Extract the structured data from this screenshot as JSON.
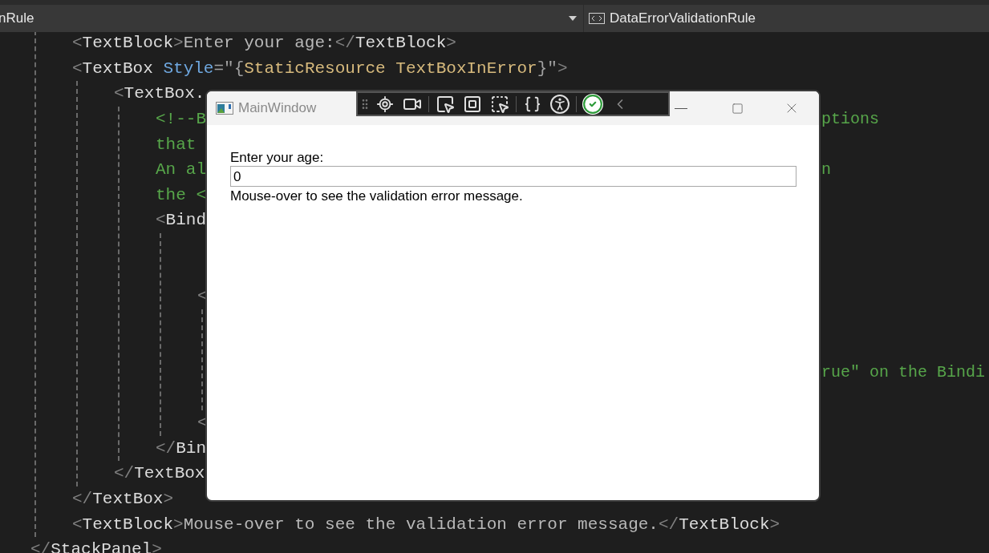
{
  "editor_header": {
    "type_dropdown": "nRule",
    "member_dropdown": "DataErrorValidationRule"
  },
  "code": {
    "lines": [
      {
        "segments": [
          {
            "kind": "bracket",
            "text": "<"
          },
          {
            "kind": "tag",
            "text": "TextBlock"
          },
          {
            "kind": "bracket",
            "text": ">"
          },
          {
            "kind": "text",
            "text": "Enter your age:"
          },
          {
            "kind": "bracket",
            "text": "</"
          },
          {
            "kind": "tag",
            "text": "TextBlock"
          },
          {
            "kind": "bracket",
            "text": ">"
          }
        ]
      },
      {
        "segments": [
          {
            "kind": "bracket",
            "text": "<"
          },
          {
            "kind": "tag",
            "text": "TextBox "
          },
          {
            "kind": "attr",
            "text": "Style"
          },
          {
            "kind": "punct",
            "text": "=\"{"
          },
          {
            "kind": "value",
            "text": "StaticResource TextBoxInError"
          },
          {
            "kind": "punct",
            "text": "}\""
          },
          {
            "kind": "bracket",
            "text": ">"
          }
        ],
        "children": [
          {
            "segments": [
              {
                "kind": "bracket",
                "text": "<"
              },
              {
                "kind": "tag",
                "text": "TextBox."
              }
            ],
            "children": [
              {
                "segments": [
                  {
                    "kind": "comment",
                    "text": "<!--B"
                  }
                ],
                "right": [
                  {
                    "kind": "comment",
                    "text": "ptions"
                  }
                ]
              },
              {
                "segments": [
                  {
                    "kind": "comment",
                    "text": "that"
                  }
                ]
              },
              {
                "segments": [
                  {
                    "kind": "comment",
                    "text": "An al"
                  }
                ],
                "right": [
                  {
                    "kind": "comment",
                    "text": "n"
                  }
                ]
              },
              {
                "segments": [
                  {
                    "kind": "comment",
                    "text": "the <"
                  }
                ]
              },
              {
                "segments": [
                  {
                    "kind": "bracket",
                    "text": "<"
                  },
                  {
                    "kind": "tag",
                    "text": "Bind"
                  }
                ],
                "children": [
                  {
                    "kind": "covered"
                  },
                  {
                    "kind": "covered"
                  },
                  {
                    "segments": [
                      {
                        "kind": "bracket",
                        "text": "<"
                      }
                    ],
                    "children": [
                      {
                        "kind": "covered"
                      },
                      {
                        "kind": "covered"
                      },
                      {
                        "kind": "covered",
                        "right": [
                          {
                            "kind": "comment",
                            "text": "rue\" on the Bindi"
                          }
                        ]
                      },
                      {
                        "kind": "covered"
                      }
                    ]
                  },
                  {
                    "segments": [
                      {
                        "kind": "bracket",
                        "text": "<"
                      }
                    ]
                  }
                ]
              },
              {
                "segments": [
                  {
                    "kind": "bracket",
                    "text": "</"
                  },
                  {
                    "kind": "tag",
                    "text": "Bin"
                  }
                ]
              }
            ]
          },
          {
            "segments": [
              {
                "kind": "bracket",
                "text": "</"
              },
              {
                "kind": "tag",
                "text": "TextBox"
              }
            ]
          }
        ]
      },
      {
        "segments": [
          {
            "kind": "bracket",
            "text": "</"
          },
          {
            "kind": "tag",
            "text": "TextBox"
          },
          {
            "kind": "bracket",
            "text": ">"
          }
        ]
      },
      {
        "segments": [
          {
            "kind": "bracket",
            "text": "<"
          },
          {
            "kind": "tag",
            "text": "TextBlock"
          },
          {
            "kind": "bracket",
            "text": ">"
          },
          {
            "kind": "text",
            "text": "Mouse-over to see the validation error message."
          },
          {
            "kind": "bracket",
            "text": "</"
          },
          {
            "kind": "tag",
            "text": "TextBlock"
          },
          {
            "kind": "bracket",
            "text": ">"
          }
        ]
      }
    ],
    "outer_closing": [
      {
        "kind": "bracket",
        "text": "</"
      },
      {
        "kind": "tag",
        "text": "StackPanel"
      },
      {
        "kind": "bracket",
        "text": ">"
      }
    ]
  },
  "app_window": {
    "title": "MainWindow",
    "label": "Enter your age:",
    "age_value": "0",
    "hint": "Mouse-over to see the validation error message."
  }
}
